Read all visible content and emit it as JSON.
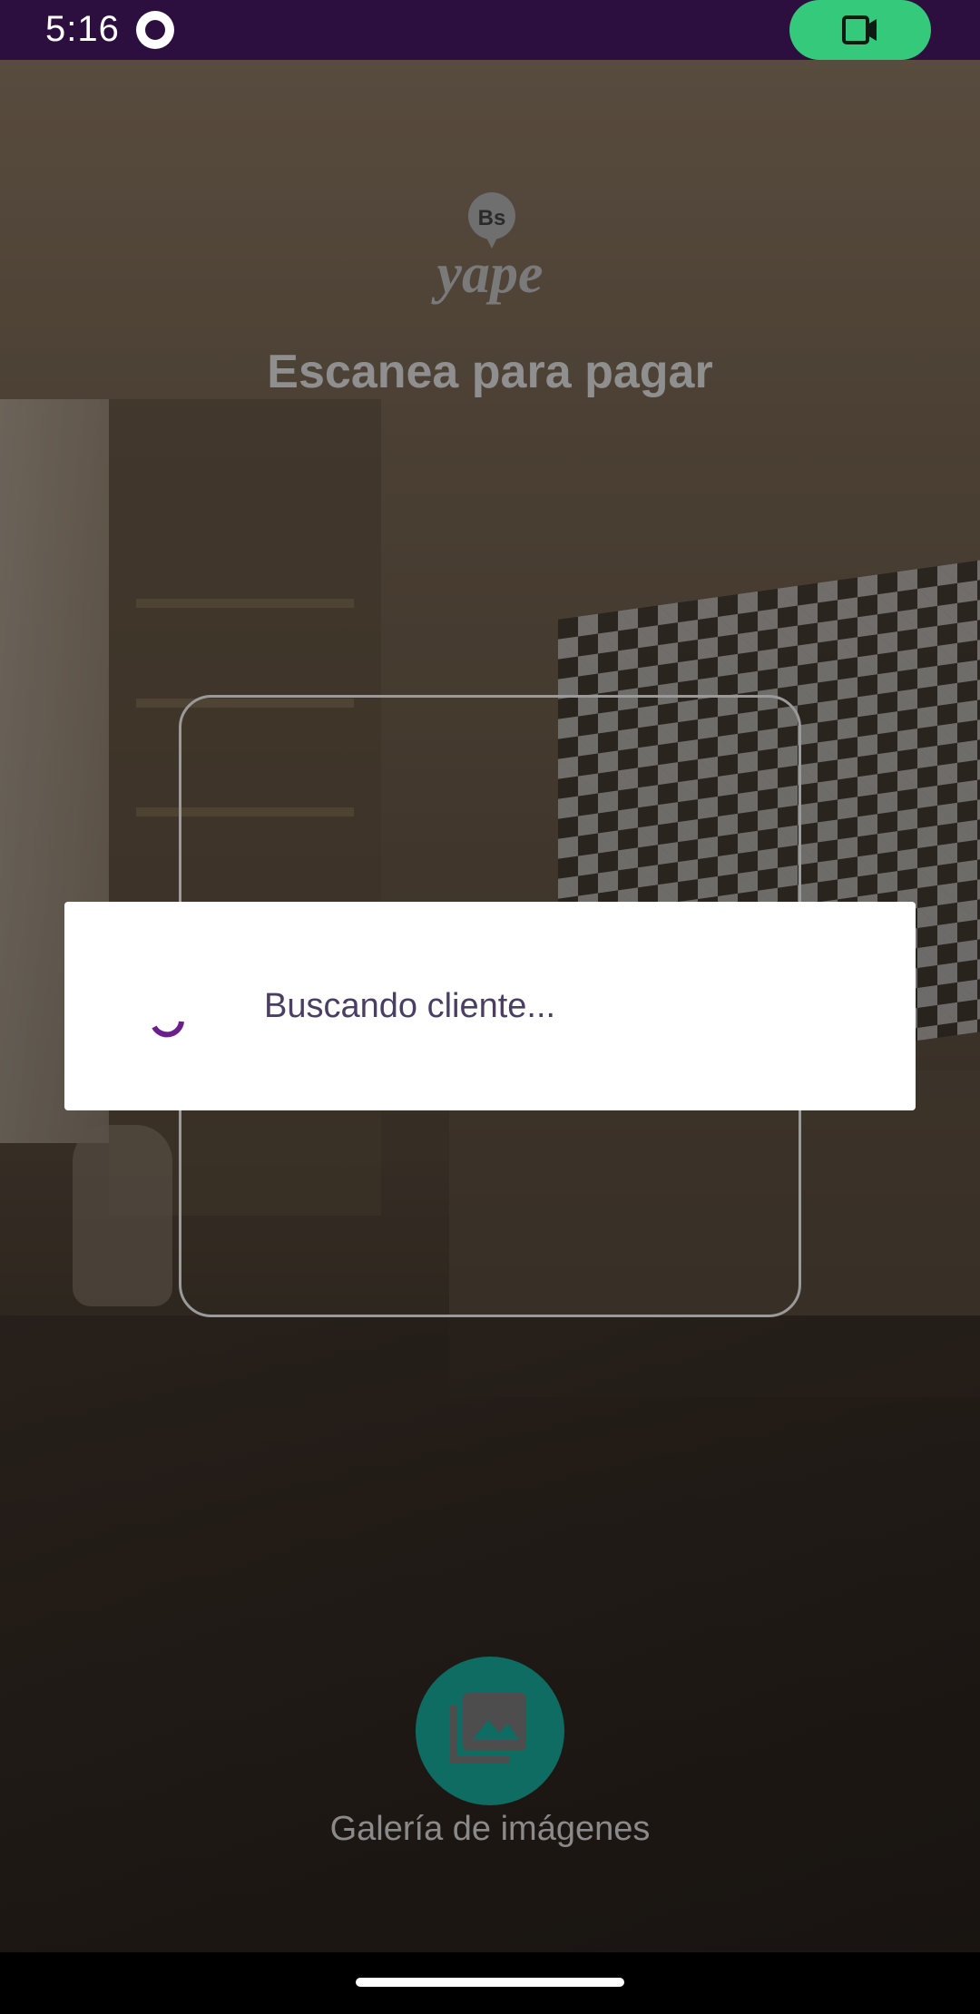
{
  "status_bar": {
    "time": "5:16"
  },
  "header": {
    "logo_badge": "Bs",
    "logo_text": "yape",
    "title": "Escanea para pagar"
  },
  "dialog": {
    "message": "Buscando cliente..."
  },
  "gallery": {
    "label": "Galería de imágenes"
  },
  "colors": {
    "status_bar": "#2d0f3f",
    "camera_pill": "#34c97b",
    "spinner_accent": "#6a1f8a",
    "gallery_button": "#0e6c63"
  },
  "icons": {
    "status_app": "sync-app-icon",
    "camera": "video-camera-icon",
    "gallery": "image-gallery-icon",
    "spinner": "loading-spinner-icon"
  }
}
